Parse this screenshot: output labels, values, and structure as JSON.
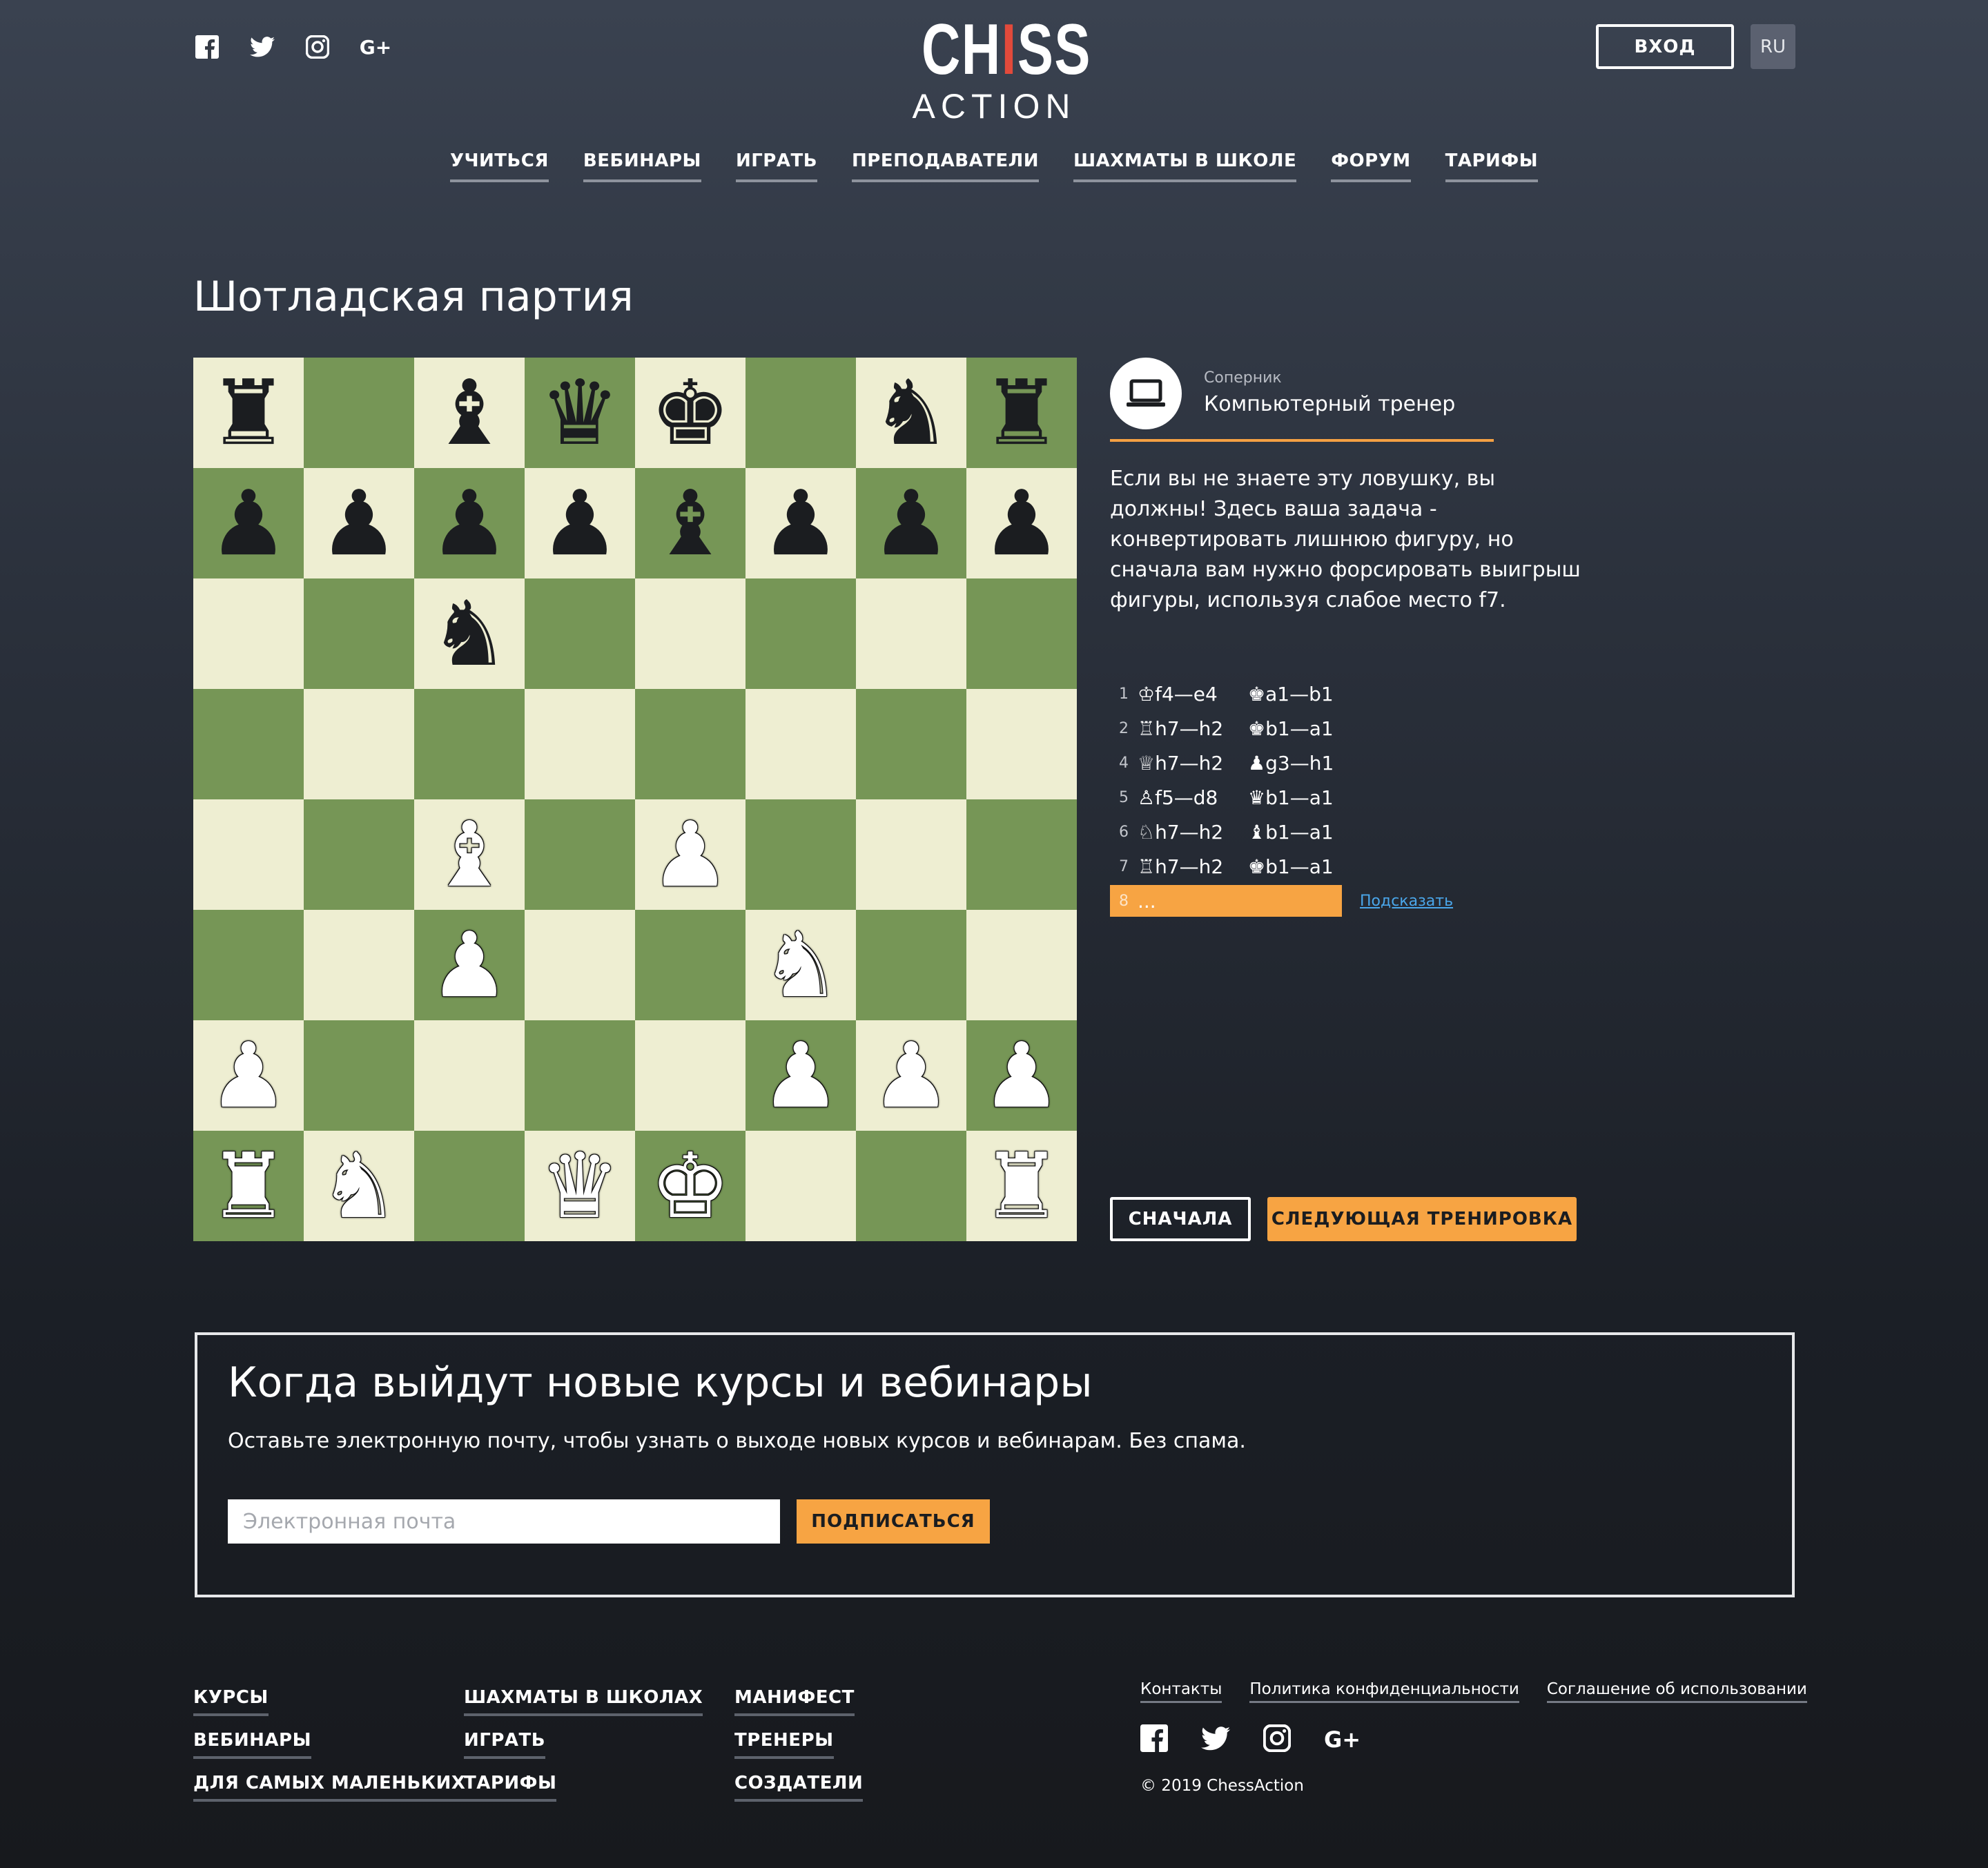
{
  "header": {
    "social_icons": [
      "facebook-icon",
      "twitter-icon",
      "instagram-icon",
      "google-plus-icon"
    ],
    "gplus_label": "G+",
    "logo_top": "CH",
    "logo_top_red": "I",
    "logo_top_end": "SS",
    "logo_bottom": "ACTION",
    "login_label": "ВХОД",
    "lang_label": "RU"
  },
  "nav": [
    "УЧИТЬСЯ",
    "ВЕБИНАРЫ",
    "ИГРАТЬ",
    "ПРЕПОДАВАТЕЛИ",
    "ШАХМАТЫ В ШКОЛЕ",
    "ФОРУМ",
    "ТАРИФЫ"
  ],
  "page": {
    "title": "Шотладская партия"
  },
  "board": {
    "light_color": "#eeeed2",
    "dark_color": "#769656",
    "rows": [
      [
        "br",
        "",
        "bb",
        "bq",
        "bk",
        "",
        "bn",
        "br"
      ],
      [
        "bp",
        "bp",
        "bp",
        "bp",
        "bb",
        "bp",
        "bp",
        "bp"
      ],
      [
        "",
        "",
        "bn",
        "",
        "",
        "",
        "",
        ""
      ],
      [
        "",
        "",
        "",
        "",
        "",
        "",
        "",
        ""
      ],
      [
        "",
        "",
        "wb",
        "",
        "wp",
        "",
        "",
        ""
      ],
      [
        "",
        "",
        "wp",
        "",
        "",
        "wn",
        "",
        ""
      ],
      [
        "wp",
        "",
        "",
        "",
        "",
        "wp",
        "wp",
        "wp"
      ],
      [
        "wr",
        "wn",
        "",
        "wq",
        "wk",
        "",
        "",
        "wr"
      ]
    ]
  },
  "opponent": {
    "label": "Соперник",
    "name": "Компьютерный тренер",
    "icon": "laptop-icon"
  },
  "description": "Если вы не знаете эту ловушку, вы должны! Здесь ваша задача - конвертировать лишнюю фигуру, но сначала вам нужно форсировать выигрыш фигуры, используя слабое место f7.",
  "moves": [
    {
      "num": "1",
      "w_icon": "♔",
      "w": "f4—e4",
      "b_icon": "♚",
      "b": "a1—b1"
    },
    {
      "num": "2",
      "w_icon": "♖",
      "w": "h7—h2",
      "b_icon": "♚",
      "b": "b1—a1"
    },
    {
      "num": "4",
      "w_icon": "♕",
      "w": "h7—h2",
      "b_icon": "♟",
      "b": "g3—h1"
    },
    {
      "num": "5",
      "w_icon": "♙",
      "w": "f5—d8",
      "b_icon": "♛",
      "b": "b1—a1"
    },
    {
      "num": "6",
      "w_icon": "♘",
      "w": "h7—h2",
      "b_icon": "♝",
      "b": "b1—a1"
    },
    {
      "num": "7",
      "w_icon": "♖",
      "w": "h7—h2",
      "b_icon": "♚",
      "b": "b1—a1"
    }
  ],
  "current_move": {
    "num": "8",
    "text": "..."
  },
  "hint_label": "Подсказать",
  "buttons": {
    "restart": "СНАЧАЛА",
    "next": "СЛЕДУЮЩАЯ ТРЕНИРОВКА"
  },
  "subscribe": {
    "title": "Когда выйдут новые курсы и вебинары",
    "text": "Оставьте электронную почту, чтобы узнать о выходе новых курсов и вебинарам. Без спама.",
    "placeholder": "Электронная почта",
    "button": "ПОДПИСАТЬСЯ"
  },
  "footer": {
    "col1": [
      "КУРСЫ",
      "ВЕБИНАРЫ",
      "ДЛЯ САМЫХ МАЛЕНЬКИХ"
    ],
    "col2": [
      "ШАХМАТЫ В ШКОЛАХ",
      "ИГРАТЬ",
      "ТАРИФЫ"
    ],
    "col3": [
      "МАНИФЕСТ",
      "ТРЕНЕРЫ",
      "СОЗДАТЕЛИ"
    ],
    "links": [
      "Контакты",
      "Политика конфиденциальности",
      "Соглашение об использовании"
    ],
    "copyright": "© 2019 ChessAction"
  },
  "colors": {
    "accent": "#f7a443",
    "link": "#4aa6ea",
    "brand_red": "#e24a3b"
  }
}
